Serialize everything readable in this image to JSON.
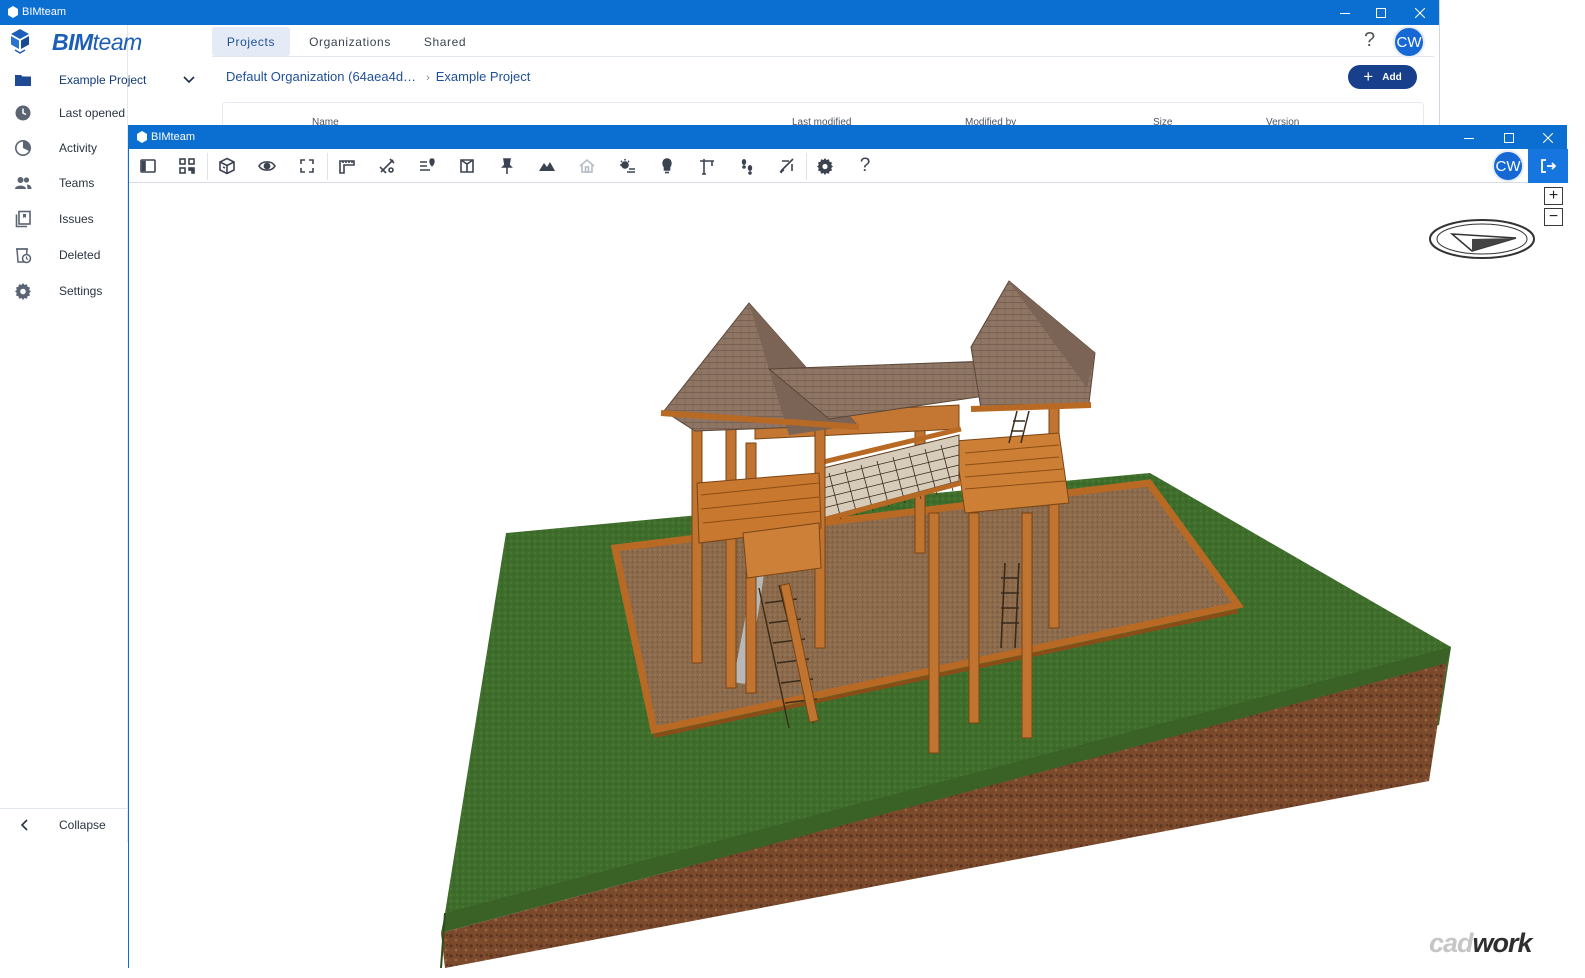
{
  "back_window": {
    "title": "BIMteam",
    "brand": {
      "part1": "BIM",
      "part2": "team"
    },
    "tabs": [
      {
        "label": "Projects",
        "active": true
      },
      {
        "label": "Organizations",
        "active": false
      },
      {
        "label": "Shared",
        "active": false
      }
    ],
    "help_label": "?",
    "avatar": "CW",
    "sidebar": {
      "project": "Example Project",
      "items": [
        {
          "label": "Last opened",
          "icon": "clock-icon"
        },
        {
          "label": "Activity",
          "icon": "activity-icon"
        },
        {
          "label": "Teams",
          "icon": "teams-icon"
        },
        {
          "label": "Issues",
          "icon": "issues-icon"
        },
        {
          "label": "Deleted",
          "icon": "deleted-icon"
        },
        {
          "label": "Settings",
          "icon": "gear-icon"
        }
      ],
      "collapse": "Collapse"
    },
    "breadcrumb": {
      "org": "Default Organization (64aea4d…",
      "project": "Example Project"
    },
    "add_label": "Add",
    "table_headers": [
      "Name",
      "Last modified",
      "Modified by",
      "Size",
      "Version"
    ]
  },
  "front_window": {
    "title": "BIMteam",
    "avatar": "CW",
    "toolbar": [
      "panel-toggle-icon",
      "qr-code-icon",
      "cube-view-icon",
      "eye-icon",
      "fullscreen-icon",
      "measure-icon",
      "markup-tools-icon",
      "location-list-icon",
      "section-box-icon",
      "pin-icon",
      "terrain-icon",
      "building-icon",
      "sun-shadow-icon",
      "light-bulb-icon",
      "crane-icon",
      "walk-icon",
      "fly-icon",
      "settings-gear-icon",
      "help-icon"
    ],
    "help_label": "?",
    "zoom_in": "+",
    "zoom_out": "−",
    "watermark": {
      "light": "cad",
      "dark": "work"
    }
  },
  "colors": {
    "accent": "#0b6fd1",
    "primary_button": "#173f8c",
    "grass": "#3d6b2a",
    "soil": "#7a4a2d",
    "wood": "#b86a24",
    "roof": "#8c7462"
  }
}
